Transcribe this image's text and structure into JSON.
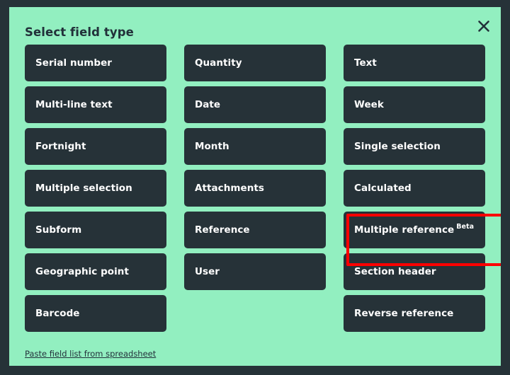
{
  "dialog": {
    "title": "Select field type",
    "close_icon": "close-icon",
    "background_color": "#92EFC0",
    "button_color": "#263238",
    "button_text_color": "#ffffff",
    "page_background_color": "#263238"
  },
  "columns": [
    {
      "items": [
        {
          "label": "Serial number",
          "badge": ""
        },
        {
          "label": "Multi-line text",
          "badge": ""
        },
        {
          "label": "Fortnight",
          "badge": ""
        },
        {
          "label": "Multiple selection",
          "badge": ""
        },
        {
          "label": "Subform",
          "badge": ""
        },
        {
          "label": "Geographic point",
          "badge": ""
        },
        {
          "label": "Barcode",
          "badge": ""
        }
      ]
    },
    {
      "items": [
        {
          "label": "Quantity",
          "badge": ""
        },
        {
          "label": "Date",
          "badge": ""
        },
        {
          "label": "Month",
          "badge": ""
        },
        {
          "label": "Attachments",
          "badge": ""
        },
        {
          "label": "Reference",
          "badge": ""
        },
        {
          "label": "User",
          "badge": ""
        }
      ]
    },
    {
      "items": [
        {
          "label": "Text",
          "badge": ""
        },
        {
          "label": "Week",
          "badge": ""
        },
        {
          "label": "Single selection",
          "badge": ""
        },
        {
          "label": "Calculated",
          "badge": ""
        },
        {
          "label": "Multiple reference",
          "badge": "Beta"
        },
        {
          "label": "Section header",
          "badge": ""
        },
        {
          "label": "Reverse reference",
          "badge": ""
        }
      ]
    }
  ],
  "footer": {
    "paste_link_label": "Paste field list from spreadsheet"
  },
  "annotation": {
    "highlight_color": "#FF0000",
    "highlighted_item": "Multiple reference"
  }
}
